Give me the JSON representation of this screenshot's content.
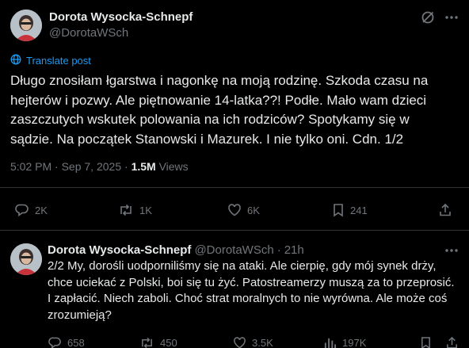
{
  "tweet": {
    "author_name": "Dorota Wysocka-Schnepf",
    "author_handle": "@DorotaWSch",
    "translate_label": "Translate post",
    "text": "Długo znosiłam łgarstwa i nagonkę na moją rodzinę. Szkoda czasu na hejterów i pozwy. Ale piętnowanie 14-latka??! Podłe. Mało wam dzieci zaszczutych wskutek polowania na ich rodziców? Spotykamy się w sądzie. Na początek Stanowski i Mazurek. I nie tylko oni. Cdn. 1/2",
    "time": "5:02 PM",
    "separator": "·",
    "date": "Sep 7, 2025",
    "views_count": "1.5M",
    "views_label": "Views",
    "replies": "2K",
    "reposts": "1K",
    "likes": "6K",
    "bookmarks": "241"
  },
  "reply": {
    "author_name": "Dorota Wysocka-Schnepf",
    "author_handle": "@DorotaWSch",
    "separator": "·",
    "age": "21h",
    "text": "2/2 My, dorośli uodporniliśmy się na ataki. Ale cierpię, gdy mój synek drży, chce uciekać z Polski, boi się tu żyć. Patostreamerzy muszą za to przeprosić. I zapłacić. Niech zaboli. Choć strat moralnych to nie wyrówna. Ale może coś zrozumieją?",
    "replies": "658",
    "reposts": "450",
    "likes": "3.5K",
    "views": "197K"
  },
  "colors": {
    "background": "#000000",
    "text": "#e7e9ea",
    "muted": "#71767b",
    "accent": "#1d9bf0",
    "divider": "#2f3336"
  },
  "icons": [
    "grok-icon",
    "more-icon",
    "globe-icon",
    "reply-icon",
    "repost-icon",
    "like-icon",
    "bookmark-icon",
    "share-icon",
    "views-icon"
  ]
}
